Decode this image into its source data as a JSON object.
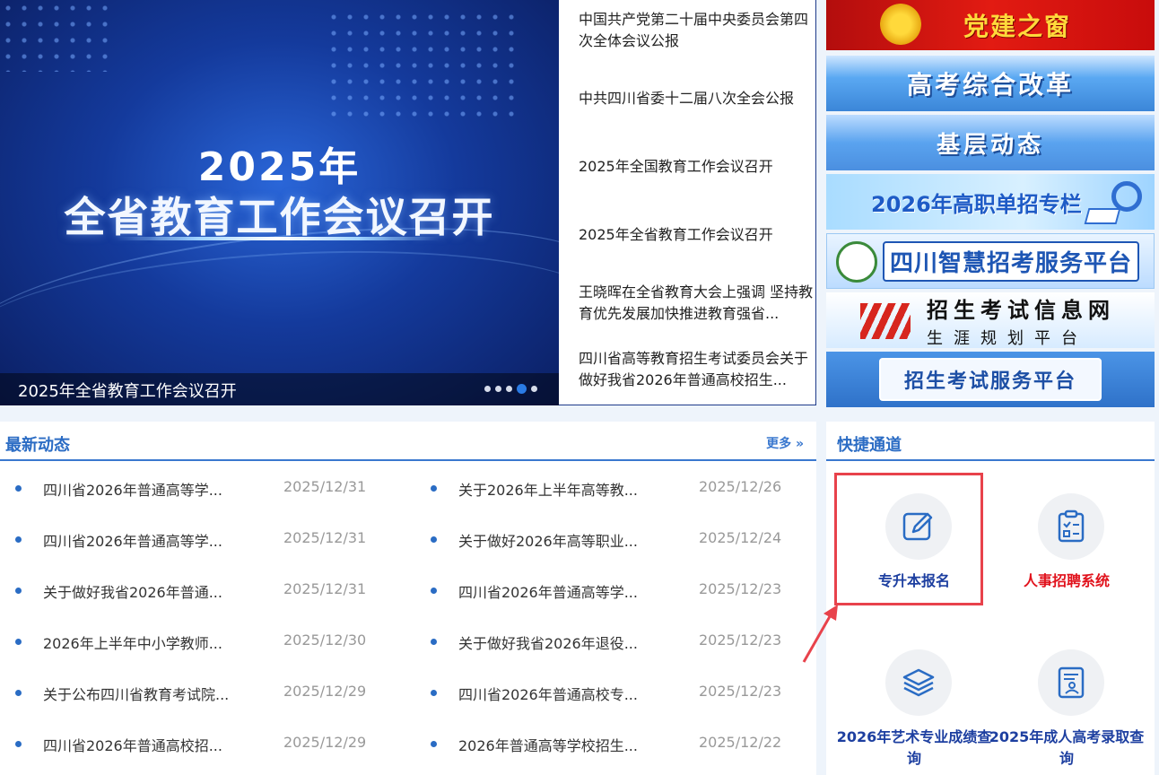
{
  "banner": {
    "year": "2025年",
    "headline": "全省教育工作会议召开",
    "caption": "2025年全省教育工作会议召开",
    "slide_count": 5,
    "active_slide": 4
  },
  "headlines": [
    "中国共产党第二十届中央委员会第四次全体会议公报",
    "中共四川省委十二届八次全会公报",
    "2025年全国教育工作会议召开",
    "2025年全省教育工作会议召开",
    "王晓晖在全省教育大会上强调 坚持教育优先发展加快推进教育强省...",
    "四川省高等教育招生考试委员会关于做好我省2026年普通高校招生..."
  ],
  "promos": {
    "party": "党建之窗",
    "gaokao_reform": "高考综合改革",
    "grassroots": "基层动态",
    "gaozhi": "2026年高职单招专栏",
    "smart_platform": "四川智慧招考服务平台",
    "info_net_line1": "招生考试信息网",
    "info_net_line2": "生涯规划平台",
    "service_platform": "招生考试服务平台"
  },
  "news": {
    "title": "最新动态",
    "more": "更多",
    "items": [
      {
        "text": "四川省2026年普通高等学...",
        "date": "2025/12/31"
      },
      {
        "text": "关于2026年上半年高等教...",
        "date": "2025/12/26"
      },
      {
        "text": "四川省2026年普通高等学...",
        "date": "2025/12/31"
      },
      {
        "text": "关于做好2026年高等职业...",
        "date": "2025/12/24"
      },
      {
        "text": "关于做好我省2026年普通...",
        "date": "2025/12/31"
      },
      {
        "text": "四川省2026年普通高等学...",
        "date": "2025/12/23"
      },
      {
        "text": "2026年上半年中小学教师...",
        "date": "2025/12/30"
      },
      {
        "text": "关于做好我省2026年退役...",
        "date": "2025/12/23"
      },
      {
        "text": "关于公布四川省教育考试院...",
        "date": "2025/12/29"
      },
      {
        "text": "四川省2026年普通高校专...",
        "date": "2025/12/23"
      },
      {
        "text": "四川省2026年普通高校招...",
        "date": "2025/12/29"
      },
      {
        "text": "2026年普通高等学校招生...",
        "date": "2025/12/22"
      }
    ]
  },
  "quick": {
    "title": "快捷通道",
    "items": [
      {
        "label": "专升本报名",
        "icon": "edit-icon"
      },
      {
        "label": "人事招聘系统",
        "icon": "checklist-icon"
      },
      {
        "label": "2026年艺术专业成绩查询",
        "icon": "layers-icon"
      },
      {
        "label": "2025年成人高考录取查询",
        "icon": "document-person-icon"
      }
    ]
  },
  "colors": {
    "accent_blue": "#2b6cc4",
    "highlight_red": "#e8424b",
    "quick_label_blue": "#1d3fa0",
    "quick_label_red": "#e1121c"
  }
}
